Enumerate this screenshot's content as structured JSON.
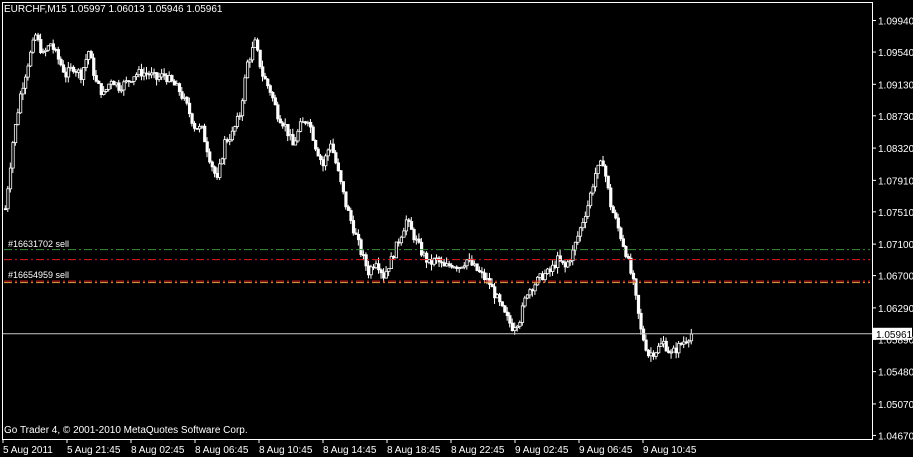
{
  "header": {
    "symbol_line": "EURCHF,M15  1.05997 1.06013 1.05946 1.05961"
  },
  "footer": {
    "copyright": "Go Trader 4, © 2001-2010 MetaQuotes Software Corp."
  },
  "orders": [
    {
      "label": "#16631702 sell",
      "price": 1.0703
    },
    {
      "label": "#16654959 sell",
      "price": 1.0663
    }
  ],
  "colors": {
    "background": "#000000",
    "candle": "#ffffff",
    "grid_frame": "#ffffff",
    "order_green": "#3a8f3a",
    "order_red": "#e02020",
    "order_orange": "#e0a040",
    "bid_line": "#c8c8c8"
  },
  "chart_data": {
    "type": "candlestick",
    "symbol": "EURCHF",
    "timeframe": "M15",
    "last_price": "1.05961",
    "ylim": [
      1.0465,
      1.1015
    ],
    "y_ticks": [
      "1.09940",
      "1.09540",
      "1.09130",
      "1.08730",
      "1.08320",
      "1.07910",
      "1.07510",
      "1.07100",
      "1.06700",
      "1.06290",
      "1.05890",
      "1.05480",
      "1.05070",
      "1.04670"
    ],
    "y_tick_values": [
      1.0994,
      1.0954,
      1.0913,
      1.0873,
      1.0832,
      1.0791,
      1.0751,
      1.071,
      1.067,
      1.0629,
      1.0589,
      1.0548,
      1.0507,
      1.0467
    ],
    "x_ticks": [
      "5 Aug 2011",
      "5 Aug 21:45",
      "8 Aug 02:45",
      "8 Aug 06:45",
      "8 Aug 10:45",
      "8 Aug 14:45",
      "8 Aug 18:45",
      "8 Aug 22:45",
      "9 Aug 02:45",
      "9 Aug 06:45",
      "9 Aug 10:45"
    ],
    "price_path": [
      [
        0,
        1.0755
      ],
      [
        3,
        1.084
      ],
      [
        6,
        1.09
      ],
      [
        9,
        1.094
      ],
      [
        12,
        1.0975
      ],
      [
        15,
        1.095
      ],
      [
        18,
        1.0965
      ],
      [
        21,
        1.0945
      ],
      [
        24,
        1.0925
      ],
      [
        27,
        1.0935
      ],
      [
        30,
        1.0925
      ],
      [
        33,
        1.0955
      ],
      [
        36,
        1.0915
      ],
      [
        39,
        1.09
      ],
      [
        42,
        1.092
      ],
      [
        45,
        1.091
      ],
      [
        48,
        1.0915
      ],
      [
        51,
        1.0925
      ],
      [
        54,
        1.0928
      ],
      [
        57,
        1.0926
      ],
      [
        60,
        1.092
      ],
      [
        63,
        1.0925
      ],
      [
        66,
        1.0915
      ],
      [
        69,
        1.0905
      ],
      [
        72,
        1.0885
      ],
      [
        75,
        1.086
      ],
      [
        78,
        1.0855
      ],
      [
        81,
        1.082
      ],
      [
        84,
        1.079
      ],
      [
        87,
        1.084
      ],
      [
        90,
        1.085
      ],
      [
        93,
        1.0875
      ],
      [
        96,
        1.094
      ],
      [
        99,
        1.0965
      ],
      [
        102,
        1.0925
      ],
      [
        105,
        1.0905
      ],
      [
        108,
        1.0875
      ],
      [
        111,
        1.086
      ],
      [
        114,
        1.0835
      ],
      [
        117,
        1.086
      ],
      [
        120,
        1.087
      ],
      [
        123,
        1.0835
      ],
      [
        126,
        1.081
      ],
      [
        129,
        1.084
      ],
      [
        132,
        1.08
      ],
      [
        135,
        1.076
      ],
      [
        138,
        1.073
      ],
      [
        141,
        1.07
      ],
      [
        144,
        1.0675
      ],
      [
        147,
        1.069
      ],
      [
        150,
        1.067
      ],
      [
        153,
        1.069
      ],
      [
        156,
        1.0715
      ],
      [
        159,
        1.074
      ],
      [
        162,
        1.072
      ],
      [
        165,
        1.07
      ],
      [
        168,
        1.0685
      ],
      [
        171,
        1.069
      ],
      [
        174,
        1.068
      ],
      [
        177,
        1.0685
      ],
      [
        180,
        1.0682
      ],
      [
        183,
        1.069
      ],
      [
        186,
        1.068
      ],
      [
        189,
        1.067
      ],
      [
        192,
        1.066
      ],
      [
        195,
        1.064
      ],
      [
        198,
        1.062
      ],
      [
        201,
        1.0605
      ],
      [
        204,
        1.0615
      ],
      [
        207,
        1.065
      ],
      [
        210,
        1.066
      ],
      [
        213,
        1.067
      ],
      [
        216,
        1.0675
      ],
      [
        219,
        1.069
      ],
      [
        222,
        1.068
      ],
      [
        225,
        1.07
      ],
      [
        228,
        1.073
      ],
      [
        231,
        1.076
      ],
      [
        234,
        1.08
      ],
      [
        237,
        1.0815
      ],
      [
        240,
        1.076
      ],
      [
        243,
        1.073
      ],
      [
        246,
        1.07
      ],
      [
        249,
        1.066
      ],
      [
        252,
        1.06
      ],
      [
        255,
        1.057
      ],
      [
        258,
        1.0575
      ],
      [
        261,
        1.0585
      ],
      [
        264,
        1.057
      ],
      [
        267,
        1.058
      ],
      [
        270,
        1.059
      ],
      [
        272,
        1.0596
      ]
    ]
  }
}
